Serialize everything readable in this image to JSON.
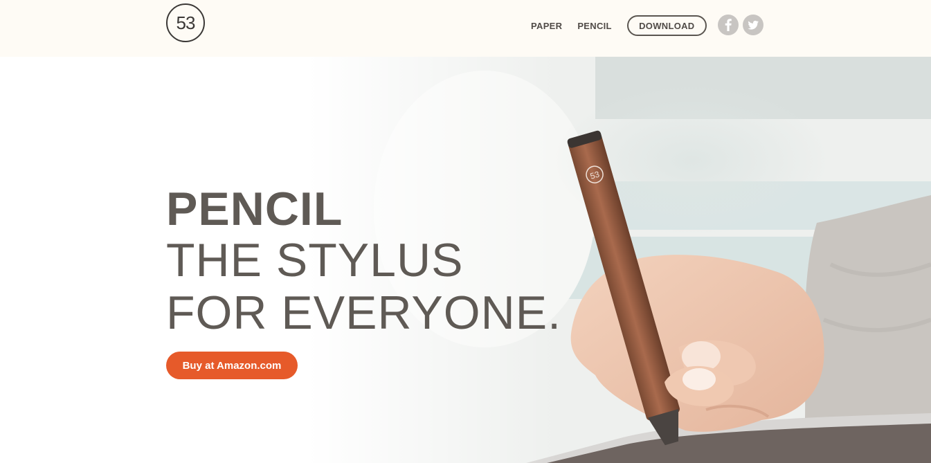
{
  "header": {
    "logo_text": "53",
    "nav": {
      "paper": "PAPER",
      "pencil": "PENCIL",
      "download": "DOWNLOAD"
    },
    "social": {
      "facebook_icon": "facebook-icon",
      "twitter_icon": "twitter-icon"
    }
  },
  "hero": {
    "title_bold": "PENCIL",
    "title_line2": "THE STYLUS",
    "title_line3": "FOR EVERYONE.",
    "cta_label": "Buy at Amazon.com",
    "pencil_logo_text": "53"
  },
  "colors": {
    "accent": "#e65a2a",
    "text": "#5f5a55",
    "header_bg": "#fefbf5",
    "icon_bg": "#c8c5c2"
  }
}
